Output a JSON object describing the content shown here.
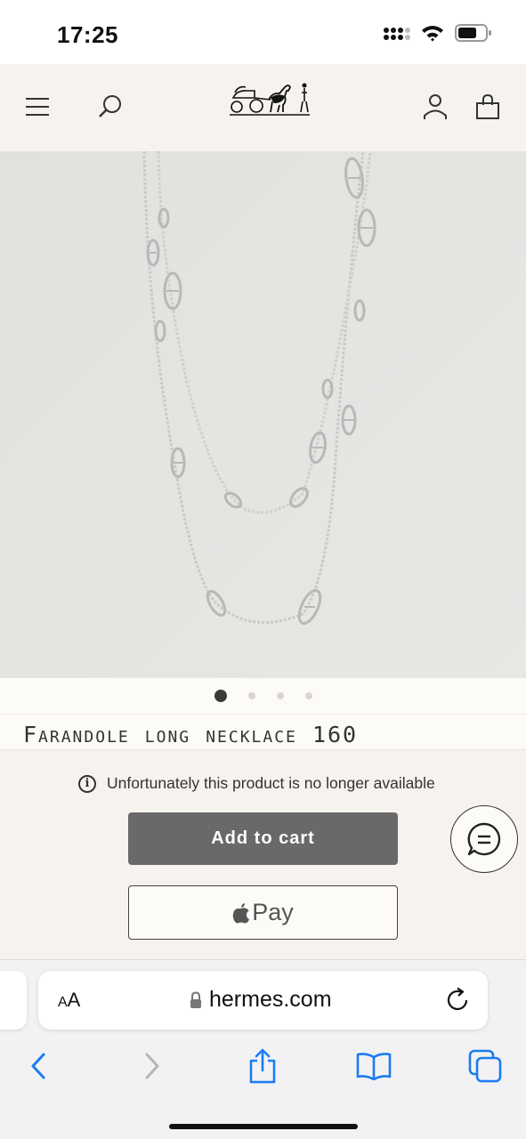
{
  "status_bar": {
    "time": "17:25",
    "icons": [
      "cellular-signal-icon",
      "wifi-icon",
      "battery-icon"
    ]
  },
  "header": {
    "menu_icon": "hamburger-menu-icon",
    "search_icon": "search-icon",
    "logo": "hermes-carriage-logo",
    "account_icon": "user-icon",
    "cart_icon": "shopping-bag-icon"
  },
  "carousel": {
    "image": "silver Farandole long necklace on grey background",
    "slide_count": 4,
    "active_index": 0
  },
  "product": {
    "title": "Farandole long necklace 160",
    "availability_text": "Unfortunately this product is no longer available",
    "add_to_cart_label": "Add to cart",
    "apple_pay_label": "Pay"
  },
  "browser": {
    "text_size_small": "A",
    "text_size_large": "A",
    "domain": "hermes.com",
    "toolbar_icons": [
      "back-icon",
      "forward-icon",
      "share-icon",
      "bookmarks-icon",
      "tabs-icon"
    ]
  },
  "colors": {
    "header_bg": "#f6f2ed",
    "image_bg": "#e6e4e1",
    "add_to_cart_bg": "#696969",
    "ios_blue": "#1b7cf0"
  }
}
